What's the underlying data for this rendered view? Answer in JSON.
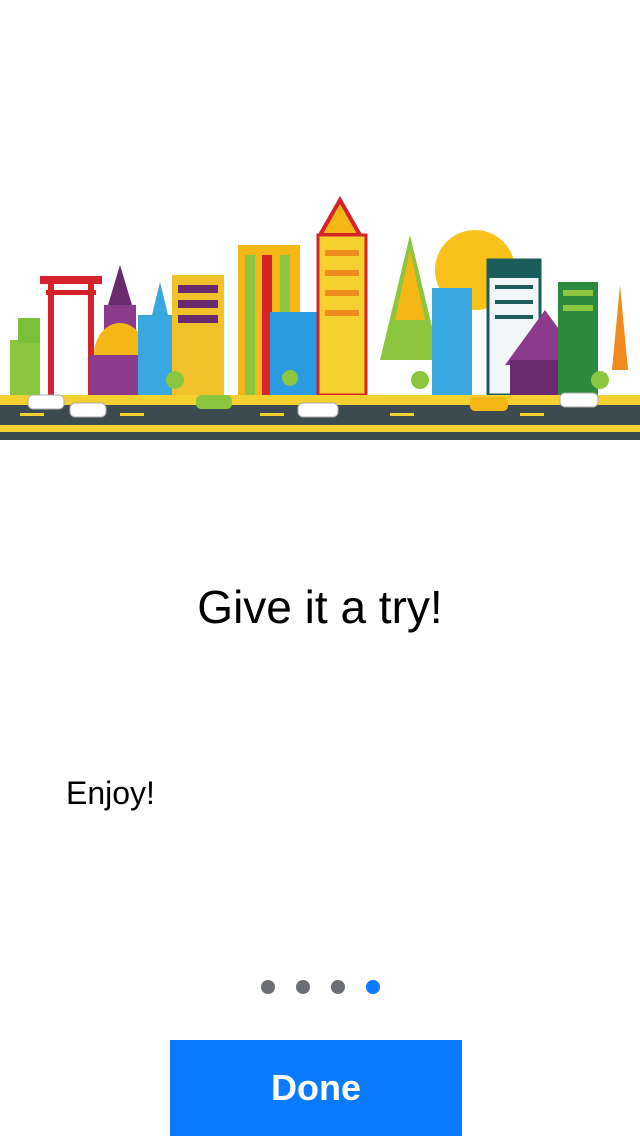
{
  "onboarding": {
    "title": "Give it a try!",
    "body": "Enjoy!",
    "illustration": "city-skyline-illustration",
    "pager": {
      "total": 4,
      "current": 4
    },
    "done_label": "Done"
  },
  "colors": {
    "accent": "#0a7bff",
    "dot_inactive": "#6b6f74",
    "text": "#000000",
    "background": "#ffffff"
  }
}
